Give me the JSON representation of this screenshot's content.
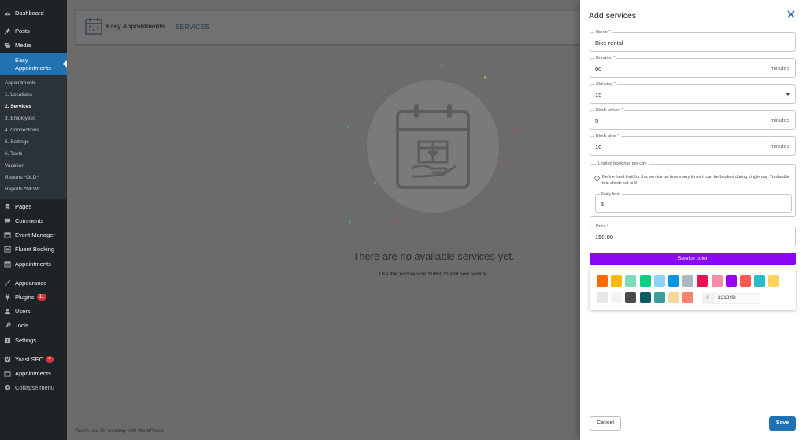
{
  "sidebar": {
    "items": [
      {
        "label": "Dashboard",
        "icon": "dashboard-icon"
      },
      {
        "label": "Posts",
        "icon": "pin-icon"
      },
      {
        "label": "Media",
        "icon": "media-icon"
      },
      {
        "label": "Pages",
        "icon": "pages-icon"
      },
      {
        "label": "Comments",
        "icon": "comments-icon"
      },
      {
        "label": "Event Manager",
        "icon": "calendar-icon"
      },
      {
        "label": "Fluent Booking",
        "icon": "calendar-icon"
      },
      {
        "label": "Appointments",
        "icon": "calendar-icon"
      },
      {
        "label": "Appearance",
        "icon": "brush-icon"
      },
      {
        "label": "Plugins",
        "icon": "plugin-icon",
        "badge": "11"
      },
      {
        "label": "Users",
        "icon": "users-icon"
      },
      {
        "label": "Tools",
        "icon": "wrench-icon"
      },
      {
        "label": "Settings",
        "icon": "settings-icon"
      },
      {
        "label": "Yoast SEO",
        "icon": "yoast-icon",
        "badge": "4"
      },
      {
        "label": "Appointments",
        "icon": "calendar-icon"
      },
      {
        "label": "Collapse menu",
        "icon": "collapse-icon"
      }
    ],
    "active": {
      "label_line1": "Easy",
      "label_line2": "Appointments"
    },
    "submenu": [
      "Appointments",
      "1. Locations",
      "2. Services",
      "3. Employees",
      "4. Connections",
      "5. Settings",
      "6. Tools",
      "Vacation",
      "Reports *OLD*",
      "Reports *NEW*"
    ],
    "submenu_current": "2. Services"
  },
  "app": {
    "name": "Easy Appointments",
    "section": "SERVICES",
    "empty_title": "There are no available services yet.",
    "empty_subtitle": "Use the 'Add service' button to add new service.",
    "footer": "Thank you for creating with WordPress."
  },
  "panel": {
    "title": "Add services",
    "fields": {
      "name": {
        "label": "Name *",
        "value": "Bike rental"
      },
      "duration": {
        "label": "Duration *",
        "value": "60",
        "suffix": "minutes"
      },
      "slot_step": {
        "label": "Slot step *",
        "value": "15"
      },
      "block_before": {
        "label": "Block before *",
        "value": "5",
        "suffix": "minutes"
      },
      "block_after": {
        "label": "Block after *",
        "value": "10",
        "suffix": "minutes"
      },
      "price": {
        "label": "Price *",
        "value": "150.00"
      }
    },
    "limit": {
      "legend": "Limit of bookings per day",
      "description": "Define hard limit for this service on how many times it can be booked during single day. To disable this check set to 0",
      "daily_label": "Daily limit",
      "daily_value": "5"
    },
    "service_color_label": "Service color",
    "service_color": "#8b07f3",
    "swatches_row1": [
      "#ff6900",
      "#fcb900",
      "#7bdcb5",
      "#00d084",
      "#8ed1fc",
      "#0693e3",
      "#abb8c3",
      "#eb144c",
      "#f78da7",
      "#9900ef",
      "#ff5a4f",
      "#2ebac6",
      "#ffd25f"
    ],
    "swatches_row2": [
      "#e6e6e6",
      "#f3f3f3",
      "#4a4a4a",
      "#0e5a63",
      "#3a9c9c",
      "#f6d99a",
      "#f7826f"
    ],
    "hex_prefix": "#",
    "hex_value": "22194D",
    "cancel_label": "Cancel",
    "save_label": "Save"
  }
}
